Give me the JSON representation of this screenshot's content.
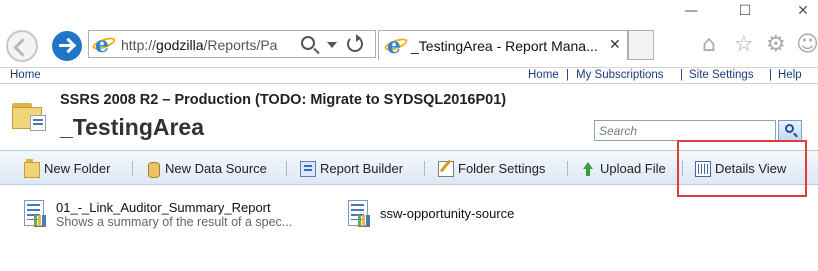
{
  "browser": {
    "url_prefix": "http://",
    "url_host": "godzilla",
    "url_path": "/Reports/Pa",
    "tab_title": "_TestingArea - Report Mana...",
    "close_glyph": "✕",
    "window_controls": {
      "minimize": "—",
      "maximize": "☐",
      "close": "✕"
    },
    "icons": [
      "back-icon",
      "forward-icon",
      "ie-logo-icon",
      "search-icon",
      "dropdown-icon",
      "refresh-icon",
      "home-icon",
      "favorites-icon",
      "settings-icon",
      "smiley-icon"
    ]
  },
  "top_nav": {
    "left_link": "Home",
    "right_links": [
      "Home",
      "My Subscriptions",
      "Site Settings",
      "Help"
    ],
    "separator": "|"
  },
  "header": {
    "subtitle": "SSRS 2008 R2 – Production (TODO: Migrate to SYDSQL2016P01)",
    "title": "_TestingArea",
    "search_placeholder": "Search"
  },
  "toolbar": {
    "items": [
      {
        "label": "New Folder",
        "icon": "new-folder-icon"
      },
      {
        "label": "New Data Source",
        "icon": "data-source-icon"
      },
      {
        "label": "Report Builder",
        "icon": "report-builder-icon"
      },
      {
        "label": "Folder Settings",
        "icon": "folder-settings-icon"
      },
      {
        "label": "Upload File",
        "icon": "upload-icon"
      },
      {
        "label": "Details View",
        "icon": "details-view-icon"
      }
    ]
  },
  "reports": [
    {
      "name": "01_-_Link_Auditor_Summary_Report",
      "description": "Shows a summary of the result of a spec..."
    },
    {
      "name": "ssw-opportunity-source",
      "description": ""
    }
  ],
  "colors": {
    "highlight": "#e03c3c",
    "link": "#1a3c7c",
    "ie_blue": "#1f76c9"
  }
}
